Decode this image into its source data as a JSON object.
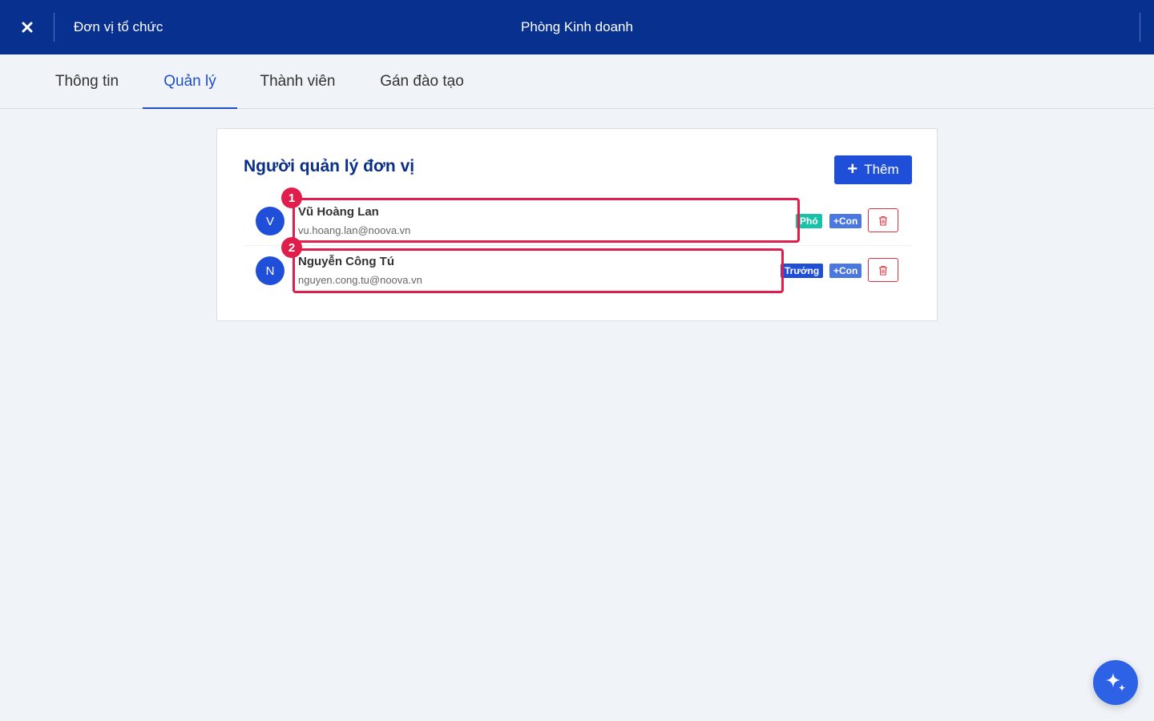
{
  "header": {
    "close_icon": "close-icon",
    "breadcrumb_parent": "Đơn vị tổ chức",
    "title": "Phòng Kinh doanh",
    "background": "#08308f"
  },
  "tabs": [
    {
      "label": "Thông tin",
      "active": false
    },
    {
      "label": "Quản lý",
      "active": true
    },
    {
      "label": "Thành viên",
      "active": false
    },
    {
      "label": "Gán đào tạo",
      "active": false
    }
  ],
  "managers_card": {
    "title": "Người quản lý đơn vị",
    "add_button": {
      "icon": "plus-icon",
      "label": "Thêm"
    },
    "managers": [
      {
        "initial": "V",
        "name": "Vũ Hoàng Lan",
        "email": "vu.hoang.lan@noova.vn",
        "role_badge": "Phó",
        "role_color": "#17c3a8",
        "sub_badge": "+Con",
        "delete_icon": "trash-icon"
      },
      {
        "initial": "N",
        "name": "Nguyễn Công Tú",
        "email": "nguyen.cong.tu@noova.vn",
        "role_badge": "Trưởng",
        "role_color": "#1f4fd9",
        "sub_badge": "+Con",
        "delete_icon": "trash-icon"
      }
    ]
  },
  "annotations": {
    "markers": [
      "1",
      "2"
    ],
    "color": "#e01e4b"
  },
  "fab": {
    "icon": "sparkle-icon",
    "color": "#2d62e6"
  }
}
